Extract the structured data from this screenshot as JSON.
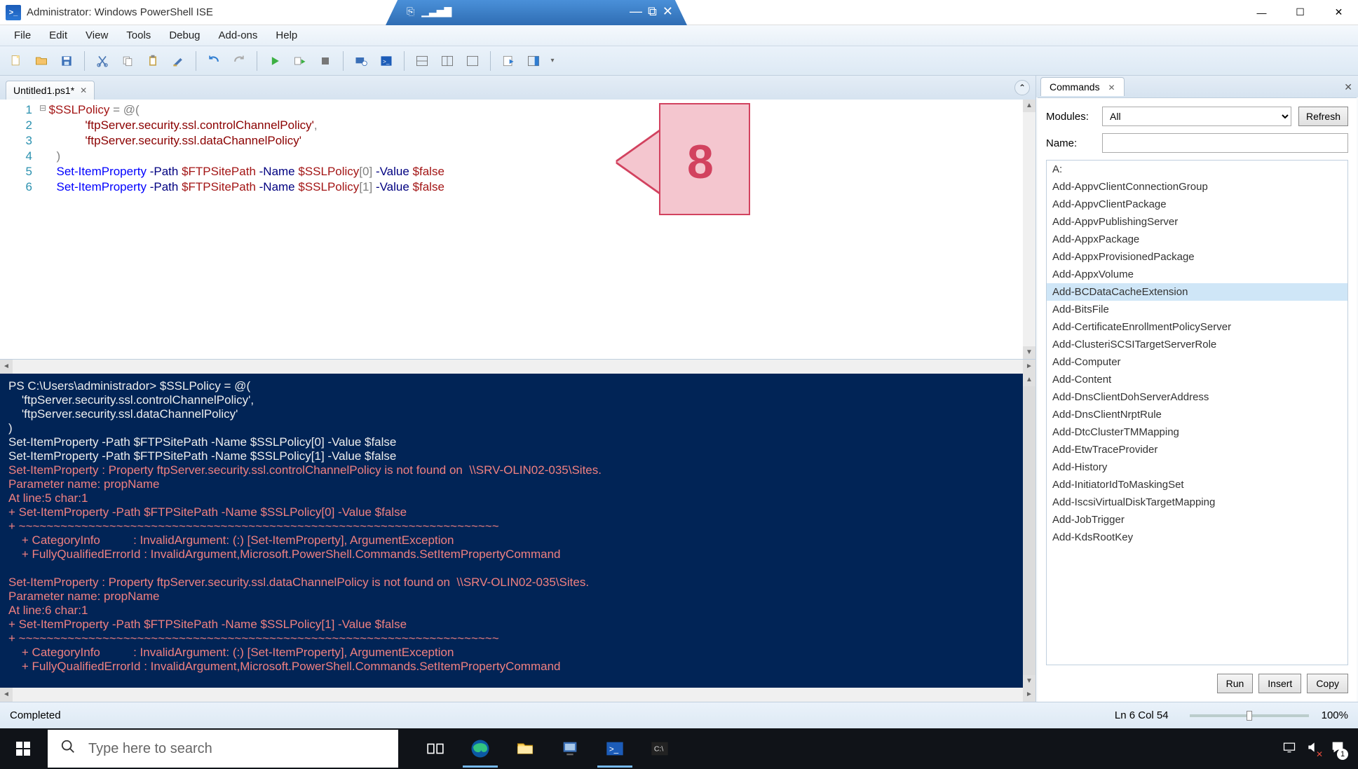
{
  "titlebar": {
    "title": "Administrator: Windows PowerShell ISE"
  },
  "menu": [
    "File",
    "Edit",
    "View",
    "Tools",
    "Debug",
    "Add-ons",
    "Help"
  ],
  "tab": {
    "name": "Untitled1.ps1*"
  },
  "annotation": {
    "number": "8"
  },
  "script": {
    "lines": [
      "1",
      "2",
      "3",
      "4",
      "5",
      "6"
    ],
    "l1_var": "$SSLPolicy",
    "l1_op": " = ",
    "l1_ar": "@(",
    "l2_str": "'ftpServer.security.ssl.controlChannelPolicy'",
    "l2_c": ",",
    "l3_str": "'ftpServer.security.ssl.dataChannelPolicy'",
    "l4": ")",
    "l56_cmd": "Set-ItemProperty",
    "l56_p1": " -Path ",
    "l56_v1": "$FTPSitePath",
    "l56_p2": " -Name ",
    "l56_v2": "$SSLPolicy",
    "l5_idx": "[0]",
    "l6_idx": "[1]",
    "l56_p3": " -Value ",
    "l56_v3": "$false"
  },
  "console": {
    "prompt": "PS C:\\Users\\administrador> ",
    "text": "PS C:\\Users\\administrador> $SSLPolicy = @(\n    'ftpServer.security.ssl.controlChannelPolicy',\n    'ftpServer.security.ssl.dataChannelPolicy'\n)\nSet-ItemProperty -Path $FTPSitePath -Name $SSLPolicy[0] -Value $false\nSet-ItemProperty -Path $FTPSitePath -Name $SSLPolicy[1] -Value $false",
    "err": "Set-ItemProperty : Property ftpServer.security.ssl.controlChannelPolicy is not found on  \\\\SRV-OLIN02-035\\Sites.\nParameter name: propName\nAt line:5 char:1\n+ Set-ItemProperty -Path $FTPSitePath -Name $SSLPolicy[0] -Value $false\n+ ~~~~~~~~~~~~~~~~~~~~~~~~~~~~~~~~~~~~~~~~~~~~~~~~~~~~~~~~~~~~~~~~~~~~~\n    + CategoryInfo          : InvalidArgument: (:) [Set-ItemProperty], ArgumentException\n    + FullyQualifiedErrorId : InvalidArgument,Microsoft.PowerShell.Commands.SetItemPropertyCommand\n\nSet-ItemProperty : Property ftpServer.security.ssl.dataChannelPolicy is not found on  \\\\SRV-OLIN02-035\\Sites.\nParameter name: propName\nAt line:6 char:1\n+ Set-ItemProperty -Path $FTPSitePath -Name $SSLPolicy[1] -Value $false\n+ ~~~~~~~~~~~~~~~~~~~~~~~~~~~~~~~~~~~~~~~~~~~~~~~~~~~~~~~~~~~~~~~~~~~~~\n    + CategoryInfo          : InvalidArgument: (:) [Set-ItemProperty], ArgumentException\n    + FullyQualifiedErrorId : InvalidArgument,Microsoft.PowerShell.Commands.SetItemPropertyCommand"
  },
  "commands": {
    "tab": "Commands",
    "modules_label": "Modules:",
    "modules_value": "All",
    "refresh": "Refresh",
    "name_label": "Name:",
    "name_value": "",
    "selected": "Add-BCDataCacheExtension",
    "list": [
      "A:",
      "Add-AppvClientConnectionGroup",
      "Add-AppvClientPackage",
      "Add-AppvPublishingServer",
      "Add-AppxPackage",
      "Add-AppxProvisionedPackage",
      "Add-AppxVolume",
      "Add-BCDataCacheExtension",
      "Add-BitsFile",
      "Add-CertificateEnrollmentPolicyServer",
      "Add-ClusteriSCSITargetServerRole",
      "Add-Computer",
      "Add-Content",
      "Add-DnsClientDohServerAddress",
      "Add-DnsClientNrptRule",
      "Add-DtcClusterTMMapping",
      "Add-EtwTraceProvider",
      "Add-History",
      "Add-InitiatorIdToMaskingSet",
      "Add-IscsiVirtualDiskTargetMapping",
      "Add-JobTrigger",
      "Add-KdsRootKey"
    ],
    "run": "Run",
    "insert": "Insert",
    "copy": "Copy"
  },
  "status": {
    "left": "Completed",
    "pos": "Ln 6  Col 54",
    "zoom": "100%"
  },
  "taskbar": {
    "search_placeholder": "Type here to search",
    "notif_count": "1"
  }
}
